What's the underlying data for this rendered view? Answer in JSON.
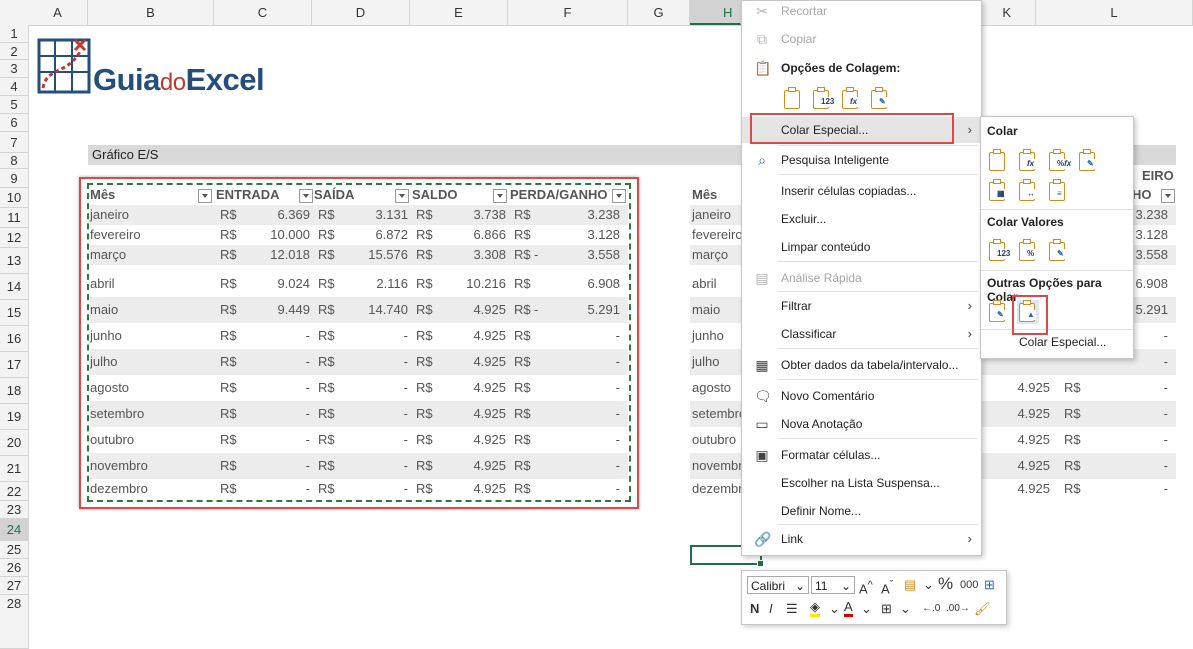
{
  "sheet": {
    "columns": [
      "A",
      "B",
      "C",
      "D",
      "E",
      "F",
      "G",
      "H",
      "K",
      "L"
    ],
    "rows": [
      "1",
      "2",
      "3",
      "4",
      "5",
      "6",
      "7",
      "8",
      "9",
      "10",
      "11",
      "12",
      "13",
      "14",
      "15",
      "16",
      "17",
      "18",
      "19",
      "20",
      "21",
      "22",
      "23",
      "24",
      "25",
      "26",
      "27",
      "28"
    ]
  },
  "logo": {
    "part1": "Guia",
    "part2": "do",
    "part3": "Excel"
  },
  "title": "Gráfico E/S",
  "table": {
    "headers": [
      "Mês",
      "ENTRADA",
      "SAÍDA",
      "SALDO",
      "PERDA/GANHO"
    ],
    "currency": "R$",
    "rows": [
      {
        "mes": "janeiro",
        "entrada": "6.369",
        "saida": "3.131",
        "saldo": "3.738",
        "pg_sign": "",
        "pg": "3.238"
      },
      {
        "mes": "fevereiro",
        "entrada": "10.000",
        "saida": "6.872",
        "saldo": "6.866",
        "pg_sign": "",
        "pg": "3.128"
      },
      {
        "mes": "março",
        "entrada": "12.018",
        "saida": "15.576",
        "saldo": "3.308",
        "pg_sign": "-",
        "pg": "3.558"
      },
      {
        "mes": "abril",
        "entrada": "9.024",
        "saida": "2.116",
        "saldo": "10.216",
        "pg_sign": "",
        "pg": "6.908"
      },
      {
        "mes": "maio",
        "entrada": "9.449",
        "saida": "14.740",
        "saldo": "4.925",
        "pg_sign": "-",
        "pg": "5.291"
      },
      {
        "mes": "junho",
        "entrada": "-",
        "saida": "-",
        "saldo": "4.925",
        "pg_sign": "",
        "pg": "-"
      },
      {
        "mes": "julho",
        "entrada": "-",
        "saida": "-",
        "saldo": "4.925",
        "pg_sign": "",
        "pg": "-"
      },
      {
        "mes": "agosto",
        "entrada": "-",
        "saida": "-",
        "saldo": "4.925",
        "pg_sign": "",
        "pg": "-"
      },
      {
        "mes": "setembro",
        "entrada": "-",
        "saida": "-",
        "saldo": "4.925",
        "pg_sign": "",
        "pg": "-"
      },
      {
        "mes": "outubro",
        "entrada": "-",
        "saida": "-",
        "saldo": "4.925",
        "pg_sign": "",
        "pg": "-"
      },
      {
        "mes": "novembro",
        "entrada": "-",
        "saida": "-",
        "saldo": "4.925",
        "pg_sign": "",
        "pg": "-"
      },
      {
        "mes": "dezembro",
        "entrada": "-",
        "saida": "-",
        "saldo": "4.925",
        "pg_sign": "",
        "pg": "-"
      }
    ]
  },
  "copy_table": {
    "header_first": "Mês",
    "header_right_top": "EIRO",
    "header_right": "HO",
    "rows": [
      {
        "mes": "janeiro",
        "k": "",
        "l": "3.238"
      },
      {
        "mes": "fevereiro",
        "k": "",
        "l": "3.128"
      },
      {
        "mes": "março",
        "k": "",
        "l": "3.558"
      },
      {
        "mes": "abril",
        "k": "",
        "l": "6.908"
      },
      {
        "mes": "maio",
        "k": "",
        "l": "5.291"
      },
      {
        "mes": "junho",
        "k": "",
        "l": "-"
      },
      {
        "mes": "julho",
        "k": "",
        "l": "-"
      },
      {
        "mes": "agosto",
        "k": "4.925",
        "l": "-"
      },
      {
        "mes": "setembro",
        "k": "4.925",
        "l": "-"
      },
      {
        "mes": "outubro",
        "k": "4.925",
        "l": "-"
      },
      {
        "mes": "novembro",
        "k": "4.925",
        "l": "-"
      },
      {
        "mes": "dezembro",
        "k": "4.925",
        "l": "-"
      }
    ]
  },
  "context_menu": {
    "recortar": "Recortar",
    "copiar": "Copiar",
    "paste_options_title": "Opções de Colagem:",
    "colar_especial": "Colar Especial...",
    "pesquisa": "Pesquisa Inteligente",
    "inserir": "Inserir células copiadas...",
    "excluir": "Excluir...",
    "limpar": "Limpar conteúdo",
    "analise": "Análise Rápida",
    "filtrar": "Filtrar",
    "classificar": "Classificar",
    "obter": "Obter dados da tabela/intervalo...",
    "novo_comentario": "Novo Comentário",
    "nova_anotacao": "Nova Anotação",
    "formatar": "Formatar células...",
    "escolher": "Escolher na Lista Suspensa...",
    "definir": "Definir Nome...",
    "link": "Link"
  },
  "submenu": {
    "colar": "Colar",
    "colar_valores": "Colar Valores",
    "outras": "Outras Opções para Colar",
    "colar_especial": "Colar Especial..."
  },
  "mini_toolbar": {
    "font": "Calibri",
    "size": "11",
    "percent": "%",
    "thousands": "000",
    "bold": "N",
    "italic": "I"
  },
  "colors": {
    "highlight_red": "#e04848",
    "excel_green": "#1e7145",
    "logo_blue": "#244f7a",
    "logo_red": "#c0392b"
  }
}
